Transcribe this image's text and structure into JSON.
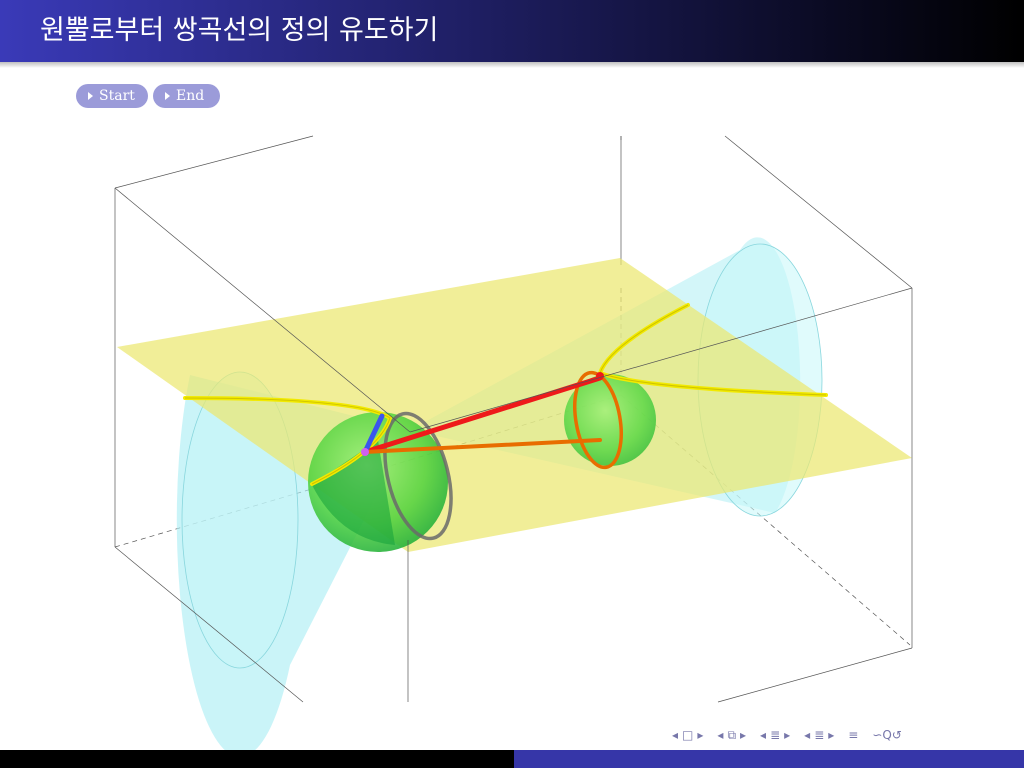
{
  "slide": {
    "title": "원뿔로부터 쌍곡선의 정의 유도하기"
  },
  "controls": {
    "start_label": "Start",
    "end_label": "End"
  },
  "colors": {
    "title_gradient_start": "#3a3ab8",
    "title_gradient_end": "#000000",
    "button": "#9b9bd9",
    "cone": "#b3f0f5",
    "plane": "#ece870",
    "sphere": "#5cd848",
    "hyperbola": "#f2ea00",
    "focal_segment": "#ee1a1a",
    "tangent_circle": "#e86d00",
    "generator_segment": "#3a56ee",
    "footer_left": "#000000",
    "footer_right": "#3636a8"
  },
  "navigation": {
    "icons": [
      "arrow-left-icon",
      "frame-icon",
      "arrow-right-icon",
      "arrow-left-icon",
      "slides-icon",
      "arrow-right-icon",
      "arrow-left-icon",
      "section-icon",
      "arrow-right-icon",
      "arrow-left-icon",
      "subsection-icon",
      "arrow-right-icon",
      "align-icon",
      "search-icon"
    ]
  }
}
